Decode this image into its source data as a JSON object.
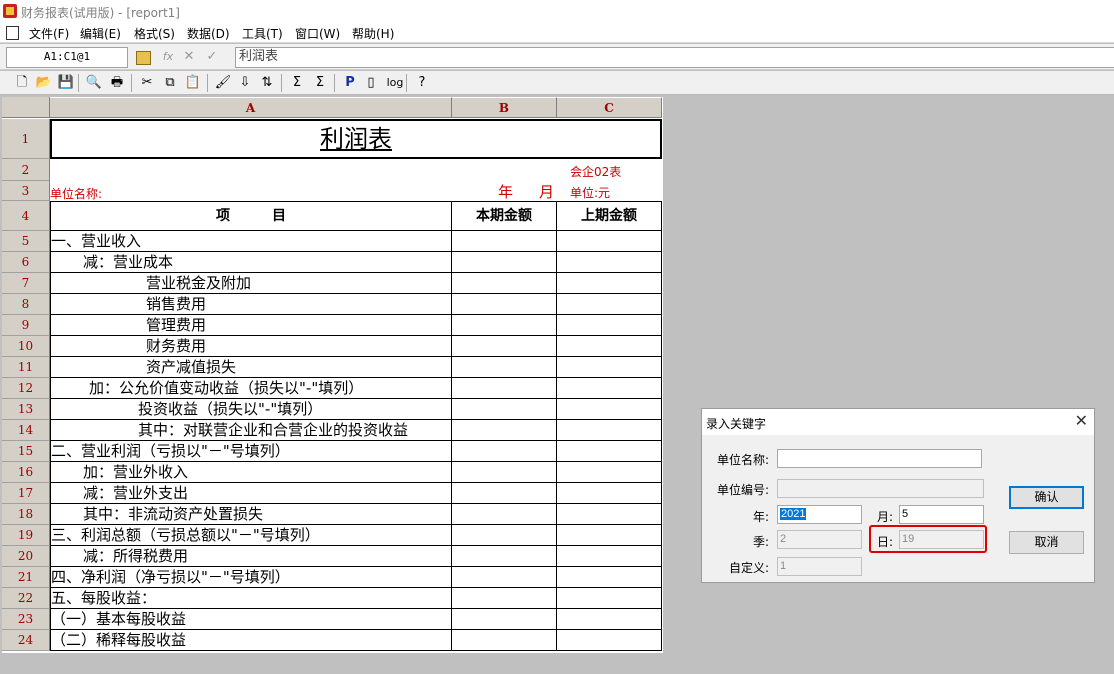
{
  "window": {
    "title": "财务报表(试用版) - [report1]"
  },
  "menu": [
    "文件(F)",
    "编辑(E)",
    "格式(S)",
    "数据(D)",
    "工具(T)",
    "窗口(W)",
    "帮助(H)"
  ],
  "formula_bar": {
    "cell_ref": "A1:C1@1",
    "fx": "fx",
    "cancel": "✕",
    "confirm": "✓",
    "content": "利润表"
  },
  "toolbar": [
    {
      "name": "new-file-icon",
      "glyph": "🗋"
    },
    {
      "name": "open-folder-icon",
      "glyph": "📂"
    },
    {
      "name": "save-icon",
      "glyph": "💾"
    },
    {
      "name": "print-preview-icon",
      "glyph": "🔍"
    },
    {
      "name": "print-icon",
      "glyph": "🖶"
    },
    {
      "name": "cut-icon",
      "glyph": "✂"
    },
    {
      "name": "copy-icon",
      "glyph": "⧉"
    },
    {
      "name": "paste-icon",
      "glyph": "📋"
    },
    {
      "name": "format-brush-icon",
      "glyph": "🖌"
    },
    {
      "name": "insert-icon",
      "glyph": "⇩"
    },
    {
      "name": "sort-icon",
      "glyph": "⇅"
    },
    {
      "name": "sum-icon",
      "glyph": "Σ"
    },
    {
      "name": "sum-column-icon",
      "glyph": "Σ"
    },
    {
      "name": "p-icon",
      "glyph": "P"
    },
    {
      "name": "insert-page-icon",
      "glyph": "▯"
    },
    {
      "name": "log-icon",
      "glyph": "log"
    },
    {
      "name": "help-pointer-icon",
      "glyph": "?"
    }
  ],
  "sheet": {
    "columns": [
      "A",
      "B",
      "C"
    ],
    "title": "利润表",
    "form_no": "会企02表",
    "unit_name_label": "单位名称:",
    "year_label": "年",
    "month_label": "月",
    "unit_label": "单位:元",
    "header": {
      "item": "项　　　目",
      "current": "本期金额",
      "previous": "上期金额"
    },
    "rows": [
      "一、营业收入",
      "减：营业成本",
      "营业税金及附加",
      "销售费用",
      "管理费用",
      "财务费用",
      "资产减值损失",
      "加：公允价值变动收益（损失以\"-\"填列）",
      "投资收益（损失以\"-\"填列）",
      "其中：对联营企业和合营企业的投资收益",
      "二、营业利润（亏损以\"－\"号填列）",
      "加：营业外收入",
      "减：营业外支出",
      "其中：非流动资产处置损失",
      "三、利润总额（亏损总额以\"－\"号填列）",
      "减：所得税费用",
      "四、净利润（净亏损以\"－\"号填列）",
      "五、每股收益：",
      "（一）基本每股收益",
      "（二）稀释每股收益"
    ],
    "row_numbers": [
      "1",
      "2",
      "3",
      "4",
      "5",
      "6",
      "7",
      "8",
      "9",
      "10",
      "11",
      "12",
      "13",
      "14",
      "15",
      "16",
      "17",
      "18",
      "19",
      "20",
      "21",
      "22",
      "23",
      "24"
    ]
  },
  "dialog": {
    "title": "录入关键字",
    "close": "✕",
    "unit_name_label": "单位名称:",
    "unit_name_value": "",
    "unit_code_label": "单位编号:",
    "unit_code_value": "",
    "year_label": "年:",
    "year_value": "2021",
    "month_label": "月:",
    "month_value": "5",
    "quarter_label": "季:",
    "quarter_value": "2",
    "day_label": "日:",
    "day_value": "19",
    "custom_label": "自定义:",
    "custom_value": "1",
    "ok_label": "确认",
    "cancel_label": "取消"
  }
}
